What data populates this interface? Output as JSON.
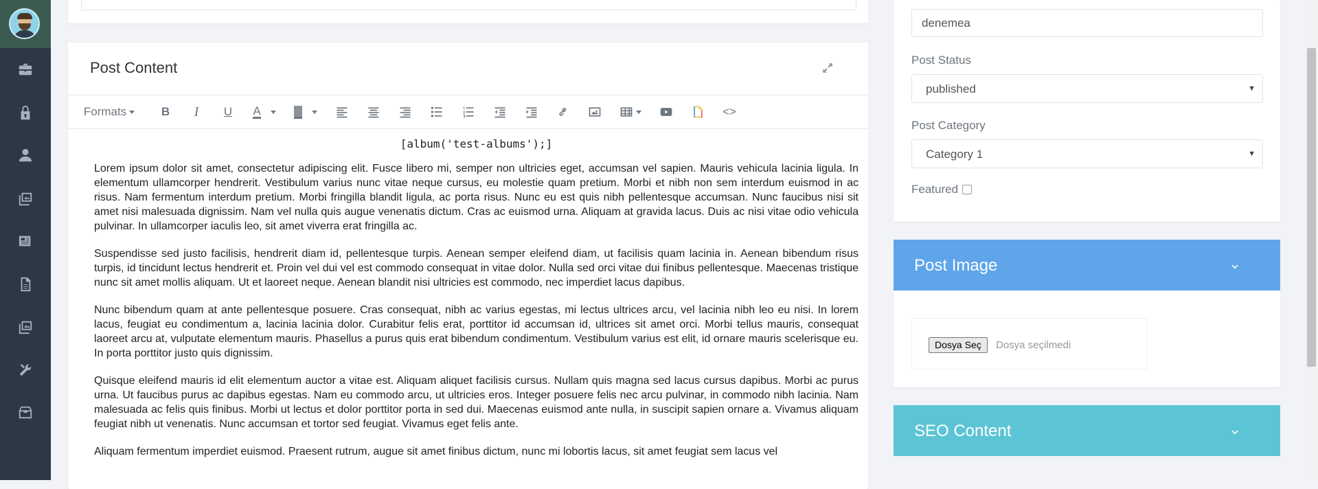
{
  "sidebar": {
    "items": [
      {
        "icon": "briefcase-icon"
      },
      {
        "icon": "lock-icon"
      },
      {
        "icon": "user-icon"
      },
      {
        "icon": "images-icon"
      },
      {
        "icon": "newspaper-icon"
      },
      {
        "icon": "file-icon"
      },
      {
        "icon": "gallery-icon"
      },
      {
        "icon": "tools-icon"
      },
      {
        "icon": "archive-icon"
      }
    ]
  },
  "post_content": {
    "title": "Post Content",
    "toolbar": {
      "formats_label": "Formats"
    },
    "shortcode": "[album('test-albums');]",
    "paragraphs": [
      "Lorem ipsum dolor sit amet, consectetur adipiscing elit. Fusce libero mi, semper non ultricies eget, accumsan vel sapien. Mauris vehicula lacinia ligula. In elementum ullamcorper hendrerit. Vestibulum varius nunc vitae neque cursus, eu molestie quam pretium. Morbi et nibh non sem interdum euismod in ac risus. Nam fermentum interdum pretium. Morbi fringilla blandit ligula, ac porta risus. Nunc eu est quis nibh pellentesque accumsan. Nunc faucibus nisi sit amet nisi malesuada dignissim. Nam vel nulla quis augue venenatis dictum. Cras ac euismod urna. Aliquam at gravida lacus. Duis ac nisi vitae odio vehicula pulvinar. In ullamcorper iaculis leo, sit amet viverra erat fringilla ac.",
      "Suspendisse sed justo facilisis, hendrerit diam id, pellentesque turpis. Aenean semper eleifend diam, ut facilisis quam lacinia in. Aenean bibendum risus turpis, id tincidunt lectus hendrerit et. Proin vel dui vel est commodo consequat in vitae dolor. Nulla sed orci vitae dui finibus pellentesque. Maecenas tristique nunc sit amet mollis aliquam. Ut et laoreet neque. Aenean blandit nisi ultricies est commodo, nec imperdiet lacus dapibus.",
      "Nunc bibendum quam at ante pellentesque posuere. Cras consequat, nibh ac varius egestas, mi lectus ultrices arcu, vel lacinia nibh leo eu nisi. In lorem lacus, feugiat eu condimentum a, lacinia lacinia dolor. Curabitur felis erat, porttitor id accumsan id, ultrices sit amet orci. Morbi tellus mauris, consequat laoreet arcu at, vulputate elementum mauris. Phasellus a purus quis erat bibendum condimentum. Vestibulum varius est elit, id ornare mauris scelerisque eu. In porta porttitor justo quis dignissim.",
      "Quisque eleifend mauris id elit elementum auctor a vitae est. Aliquam aliquet facilisis cursus. Nullam quis magna sed lacus cursus dapibus. Morbi ac purus urna. Ut faucibus purus ac dapibus egestas. Nam eu commodo arcu, ut ultricies eros. Integer posuere felis nec arcu pulvinar, in commodo nibh lacinia. Nam malesuada ac felis quis finibus. Morbi ut lectus et dolor porttitor porta in sed dui. Maecenas euismod ante nulla, in suscipit sapien ornare a. Vivamus aliquam feugiat nibh ut venenatis. Nunc accumsan et tortor sed feugiat. Vivamus eget felis ante.",
      "Aliquam fermentum imperdiet euismod. Praesent rutrum, augue sit amet finibus dictum, nunc mi lobortis lacus, sit amet feugiat sem lacus vel"
    ]
  },
  "settings": {
    "slug_value": "denemea",
    "status_label": "Post Status",
    "status_value": "published",
    "category_label": "Post Category",
    "category_value": "Category 1",
    "featured_label": "Featured"
  },
  "post_image": {
    "title": "Post Image",
    "file_button": "Dosya Seç",
    "file_status": "Dosya seçilmedi",
    "color": "#5fa5ea"
  },
  "seo_content": {
    "title": "SEO Content",
    "color": "#5bc5d5"
  }
}
